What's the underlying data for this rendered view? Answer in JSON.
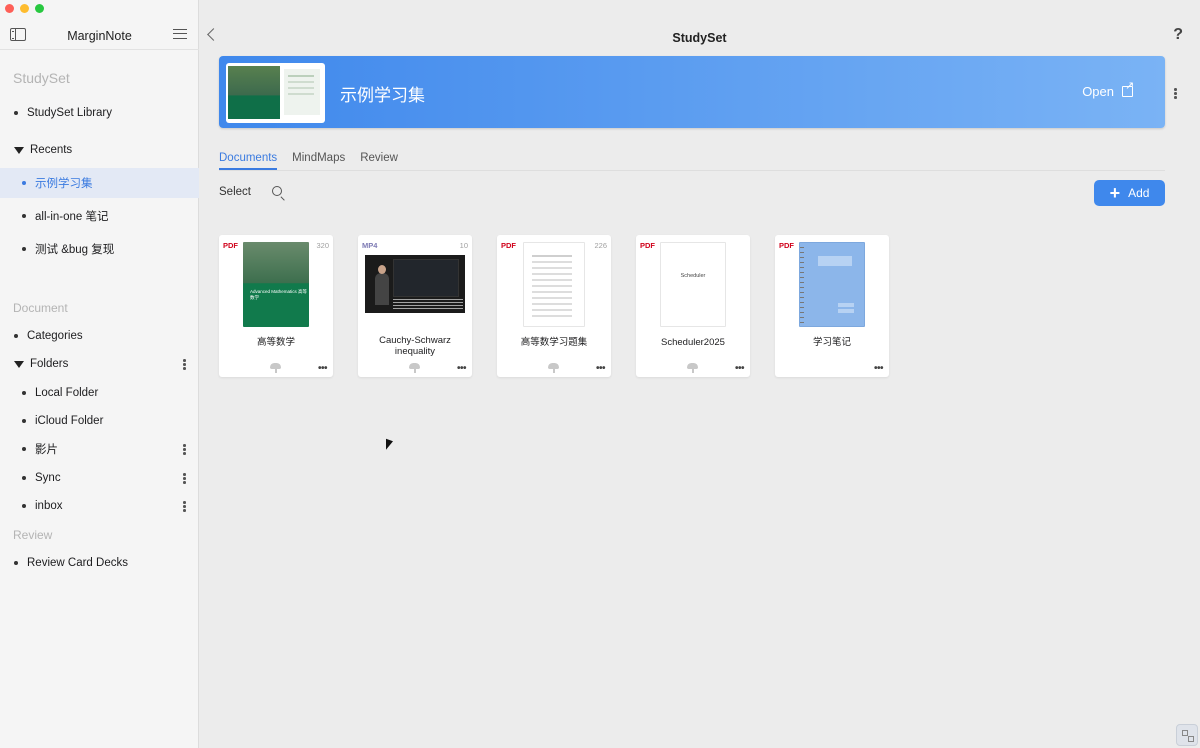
{
  "sidebar": {
    "title": "MarginNote",
    "studyset_header": "StudySet",
    "studyset_library": "StudySet Library",
    "recents_label": "Recents",
    "recents": [
      "示例学习集",
      "all-in-one 笔记",
      "测试 &bug 复现"
    ],
    "document_header": "Document",
    "categories": "Categories",
    "folders_label": "Folders",
    "folders": [
      "Local Folder",
      "iCloud Folder",
      "影片",
      "Sync",
      "inbox"
    ],
    "review_header": "Review",
    "review_card_decks": "Review Card Decks"
  },
  "topbar": {
    "title": "StudySet",
    "help": "?"
  },
  "banner": {
    "title": "示例学习集",
    "open_label": "Open"
  },
  "tabs": [
    "Documents",
    "MindMaps",
    "Review"
  ],
  "toolbar": {
    "select_label": "Select",
    "add_label": "Add"
  },
  "documents": [
    {
      "type": "PDF",
      "pages": "320",
      "name": "高等数学",
      "cover_text": "Advanced Mathematics 高等数学"
    },
    {
      "type": "MP4",
      "pages": "10",
      "name": "Cauchy-Schwarz inequality"
    },
    {
      "type": "PDF",
      "pages": "226",
      "name": "高等数学习题集"
    },
    {
      "type": "PDF",
      "pages": "",
      "name": "Scheduler2025",
      "cover_text": "Scheduler"
    },
    {
      "type": "PDF",
      "pages": "",
      "name": "学习笔记"
    }
  ],
  "colors": {
    "accent": "#3f88ec",
    "active_text": "#3b7be0",
    "pdf_label": "#d0021b",
    "mp4_label": "#7e7bb4"
  }
}
